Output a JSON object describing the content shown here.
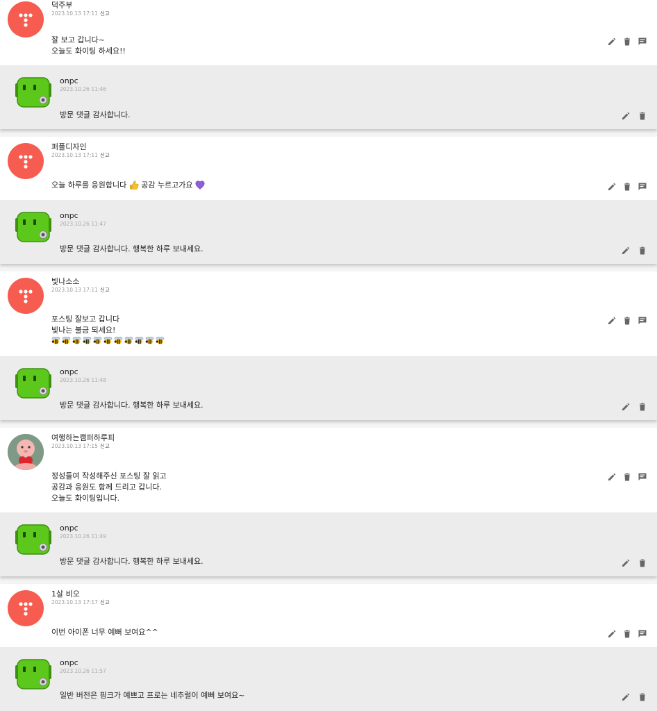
{
  "comments": [
    {
      "author": "덕주부",
      "date": "2023.10.13 17:11",
      "report_label": "신고",
      "lines": [
        "잘 보고 갑니다~",
        "오늘도 화이팅 하세요!!"
      ],
      "avatar": "default-avatar",
      "reply": {
        "author": "onpc",
        "date": "2023.10.26 11:46",
        "lines": [
          "방문 댓글 감사합니다."
        ]
      }
    },
    {
      "author": "퍼플디자인",
      "date": "2023.10.13 17:11",
      "report_label": "신고",
      "lines": [
        "오늘 하루를 응원합니다",
        "공감 누르고가요"
      ],
      "avatar": "default-avatar",
      "emojis": [
        "thumbs-up-emoji",
        "purple-heart-emoji"
      ],
      "reply": {
        "author": "onpc",
        "date": "2023.10.26 11:47",
        "lines": [
          "방문 댓글 감사합니다. 행복한 하루 보내세요."
        ]
      }
    },
    {
      "author": "빛나소소",
      "date": "2023.10.13 17:11",
      "report_label": "신고",
      "lines": [
        "포스팅 잘보고 갑니다",
        "빛나는 불금 되세요!"
      ],
      "avatar": "default-avatar",
      "bee_emoji_count": 11,
      "reply": {
        "author": "onpc",
        "date": "2023.10.26 11:48",
        "lines": [
          "방문 댓글 감사합니다. 행복한 하루 보내세요."
        ]
      }
    },
    {
      "author": "여행하는캠퍼하루피",
      "date": "2023.10.13 17:15",
      "report_label": "신고",
      "lines": [
        "정성들여 작성해주신 포스팅 잘 읽고",
        "공감과 응원도 함께 드리고 갑니다.",
        "오늘도 화이팅입니다."
      ],
      "avatar": "pink-character-avatar",
      "reply": {
        "author": "onpc",
        "date": "2023.10.26 11:49",
        "lines": [
          "방문 댓글 감사합니다. 행복한 하루 보내세요."
        ]
      }
    },
    {
      "author": "1살 비오",
      "date": "2023.10.13 17:17",
      "report_label": "신고",
      "lines": [
        "이번 아이폰 너무 예뻐 보여요^^"
      ],
      "avatar": "default-avatar",
      "reply": {
        "author": "onpc",
        "date": "2023.10.26 11:57",
        "lines": [
          "일반 버전은 핑크가 예쁘고 프로는 네추럴이 예뻐 보여요~"
        ]
      }
    }
  ],
  "icons": {
    "edit": "pencil-icon",
    "delete": "trash-icon",
    "reply": "comment-icon"
  },
  "colors": {
    "default_avatar": "#f65c4f",
    "reply_background": "#ececec",
    "reply_avatar": "#5cc81b"
  }
}
